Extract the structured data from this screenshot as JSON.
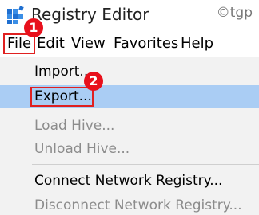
{
  "window": {
    "title": "Registry Editor",
    "app_icon": "registry-editor-icon",
    "watermark": "©tgp"
  },
  "menubar": {
    "items": [
      {
        "label": "File"
      },
      {
        "label": "Edit"
      },
      {
        "label": "View"
      },
      {
        "label": "Favorites"
      },
      {
        "label": "Help"
      }
    ]
  },
  "file_menu": {
    "items": [
      {
        "label": "Import...",
        "enabled": true
      },
      {
        "label": "Export...",
        "enabled": true,
        "highlighted": true
      },
      {
        "label": "Load Hive...",
        "enabled": false
      },
      {
        "label": "Unload Hive...",
        "enabled": false
      },
      {
        "label": "Connect Network Registry...",
        "enabled": true
      },
      {
        "label": "Disconnect Network Registry...",
        "enabled": false
      }
    ]
  },
  "annotations": {
    "step1": "1",
    "step2": "2",
    "highlight_color": "#e02020",
    "badge_color": "#e8101c"
  },
  "colors": {
    "menu_background": "#f2f2f2",
    "selection": "#aacdf4",
    "disabled_text": "#8c8c8c"
  }
}
